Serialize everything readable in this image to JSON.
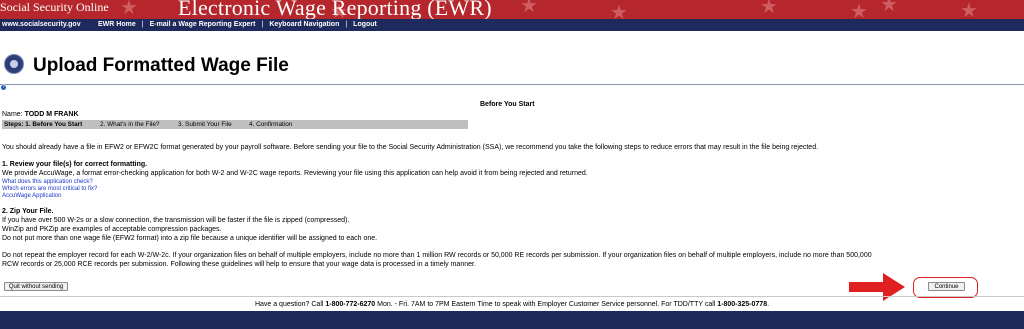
{
  "header": {
    "site_name": "Social Security Online",
    "app_title": "Electronic Wage Reporting (EWR)",
    "background_color": "#b5272c"
  },
  "nav": {
    "url": "www.socialsecurity.gov",
    "links": [
      "EWR Home",
      "E-mail a Wage Reporting Expert",
      "Keyboard Navigation",
      "Logout"
    ],
    "separator": "|",
    "background_color": "#1e2a5c"
  },
  "page": {
    "title": "Upload Formatted Wage File",
    "seal_icon": "ssa-seal-icon",
    "help_icon": "help-icon",
    "section_heading": "Before You Start"
  },
  "user": {
    "name_label": "Name:",
    "name_value": "TODD M FRANK"
  },
  "steps": [
    "Steps: 1. Before You Start",
    "2. What's in the File?",
    "3. Submit Your File",
    "4. Confirmation"
  ],
  "content": {
    "intro": "You should already have a file in EFW2 or EFW2C format generated by your payroll software. Before sending your file to the Social Security Administration (SSA), we recommend you take the following steps to reduce errors that may result in the file being rejected.",
    "review_heading": "1. Review your file(s) for correct formatting.",
    "review_text": "We provide AccuWage, a format error-checking application for both W-2 and W-2C wage reports. Reviewing your file using this application can help avoid it from being rejected and returned.",
    "review_links": [
      "What does this application check?",
      "Which errors are most critical to fix?",
      "AccuWage Application"
    ],
    "zip_heading": "2. Zip Your File.",
    "zip_lines": [
      "If you have over 500 W-2s or a slow connection, the transmission will be faster if the file is zipped (compressed).",
      "WinZip and PKZip are examples of acceptable compression packages.",
      "Do not put more than one wage file (EFW2 format) into a zip file because a unique identifier will be assigned to each one."
    ],
    "repeat_lines": [
      "Do not repeat the employer record for each W-2/W-2c. If your organization files on behalf of multiple employers, include no more than 1 million RW records or 50,000 RE records per submission. If your organization files on behalf of multiple employers, include no more than 500,000",
      "RCW records or 25,000 RCE records per submission. Following these guidelines will help to ensure that your wage data is processed in a timely manner."
    ]
  },
  "buttons": {
    "quit": "Quit without sending",
    "continue": "Continue"
  },
  "footer": {
    "prefix": "Have a question? Call ",
    "phone": "1-800-772-6270",
    "middle": " Mon. - Fri. 7AM to 7PM Eastern Time to speak with Employer Customer Service personnel. For TDD/TTY call ",
    "tty": "1-800-325-0778",
    "suffix": "."
  },
  "annotation": {
    "arrow_color": "#e02020"
  }
}
